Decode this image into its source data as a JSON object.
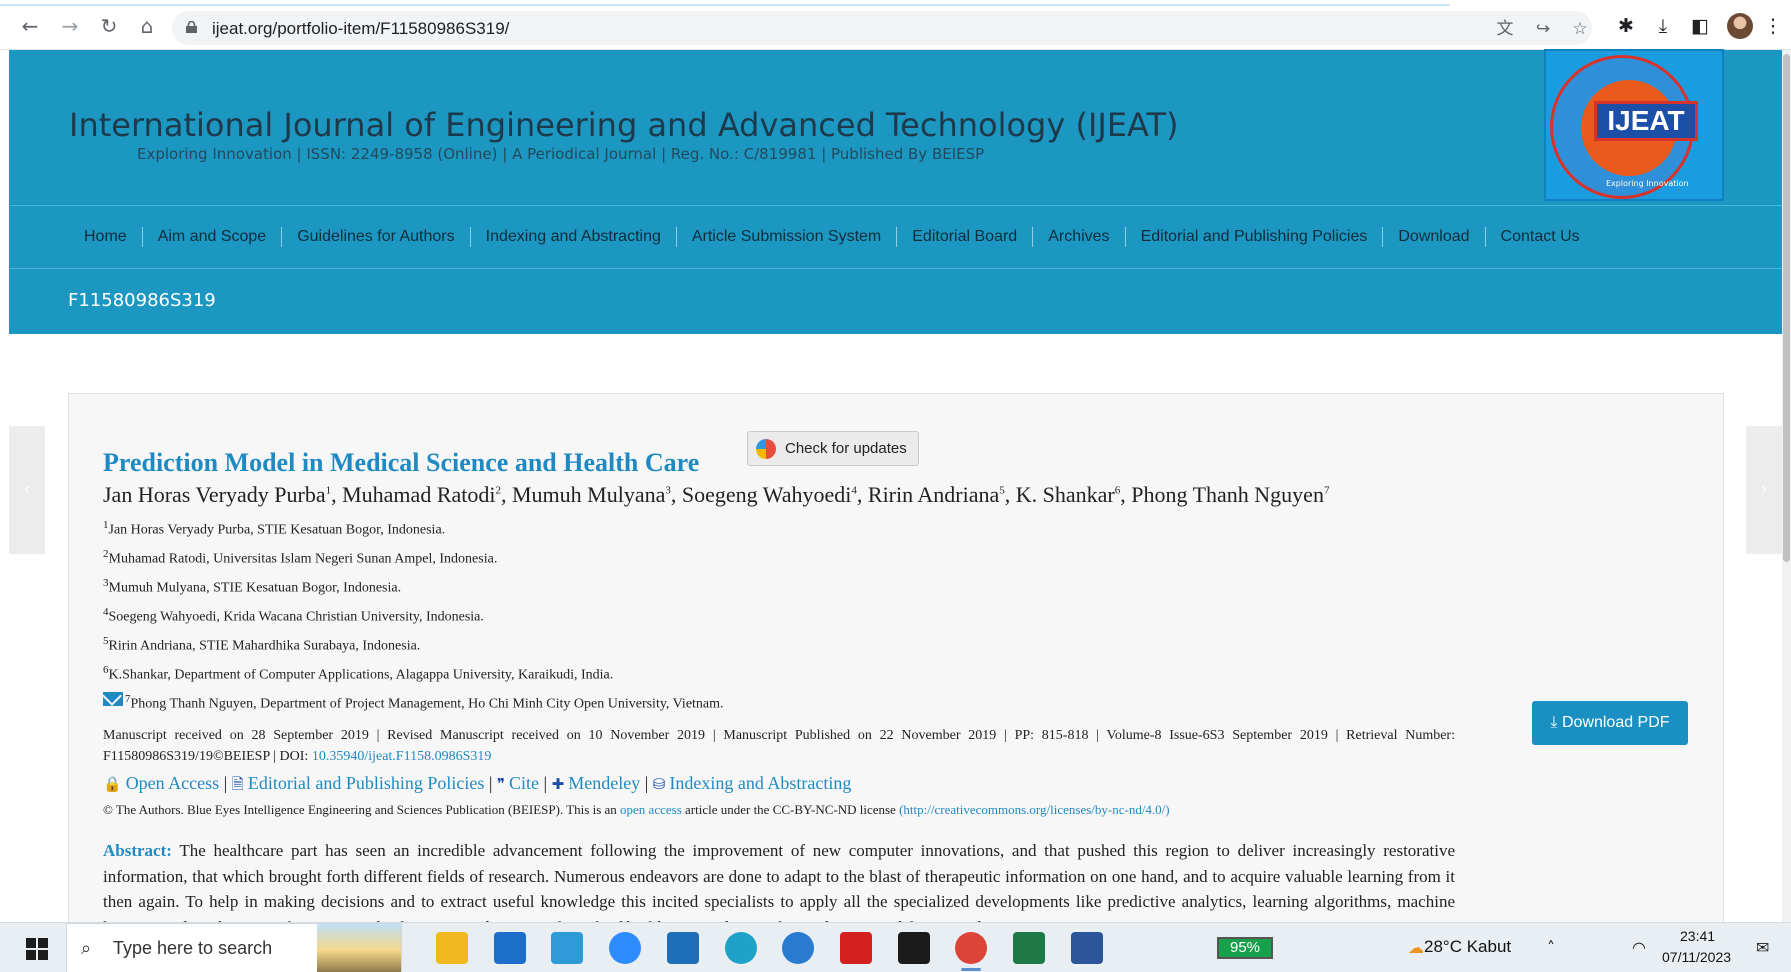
{
  "browser": {
    "url": "ijeat.org/portfolio-item/F11580986S319/",
    "nav_icons": [
      "back-arrow-icon",
      "forward-arrow-icon",
      "reload-icon",
      "home-icon"
    ],
    "glyphs": {
      "back": "←",
      "forward": "→",
      "reload": "↻",
      "home": "⌂",
      "translate": "文",
      "share": "↪",
      "star": "☆",
      "puzzle": "✱",
      "download": "⤓",
      "sidepanel": "◧",
      "menu": "⋮"
    }
  },
  "site": {
    "title": "International Journal of Engineering and Advanced Technology (IJEAT)",
    "subtitle": "Exploring Innovation | ISSN: 2249-8958 (Online) | A Periodical Journal | Reg. No.: C/819981 | Published By BEIESP",
    "logo_text": "IJEAT",
    "logo_tagline": "Exploring Innovation",
    "nav": [
      "Home",
      "Aim and Scope",
      "Guidelines for Authors",
      "Indexing and Abstracting",
      "Article Submission System",
      "Editorial Board",
      "Archives",
      "Editorial and Publishing Policies",
      "Download",
      "Contact Us"
    ],
    "page_id": "F11580986S319",
    "prev_arrow": "‹",
    "next_arrow": "›"
  },
  "article": {
    "title": "Prediction Model in Medical Science and Health Care",
    "check_updates": "Check for updates",
    "authors": [
      {
        "name": "Jan Horas Veryady Purba",
        "n": "1"
      },
      {
        "name": "Muhamad Ratodi",
        "n": "2"
      },
      {
        "name": "Mumuh Mulyana",
        "n": "3"
      },
      {
        "name": "Soegeng Wahyoedi",
        "n": "4"
      },
      {
        "name": "Ririn Andriana",
        "n": "5"
      },
      {
        "name": "K. Shankar",
        "n": "6"
      },
      {
        "name": "Phong Thanh Nguyen",
        "n": "7"
      }
    ],
    "affiliations": [
      {
        "n": "1",
        "text": "Jan Horas Veryady Purba, STIE Kesatuan Bogor, Indonesia."
      },
      {
        "n": "2",
        "text": "Muhamad Ratodi, Universitas Islam Negeri Sunan Ampel, Indonesia."
      },
      {
        "n": "3",
        "text": "Mumuh Mulyana, STIE Kesatuan Bogor, Indonesia."
      },
      {
        "n": "4",
        "text": "Soegeng Wahyoedi, Krida Wacana Christian University, Indonesia."
      },
      {
        "n": "5",
        "text": "Ririn Andriana, STIE Mahardhika Surabaya, Indonesia."
      },
      {
        "n": "6",
        "text": "K.Shankar, Department of Computer Applications, Alagappa University, Karaikudi, India."
      },
      {
        "n": "7",
        "text": "Phong Thanh Nguyen, Department of Project Management, Ho Chi Minh City Open University, Vietnam."
      }
    ],
    "meta_line": "Manuscript received on 28 September 2019 | Revised Manuscript received on 10 November 2019 | Manuscript Published on 22 November 2019 | PP: 815-818 | Volume-8 Issue-6S3 September 2019 | Retrieval Number:",
    "retrieval": "F11580986S319/19©BEIESP | DOI: ",
    "doi": "10.35940/ijeat.F1158.0986S319",
    "links": {
      "open_access": "Open Access",
      "policies": "Editorial and Publishing Policies",
      "cite": "Cite",
      "mendeley": "Mendeley",
      "indexing": "Indexing and Abstracting",
      "sep": " | ",
      "glyphs": {
        "lock": "🔒",
        "doc": "🗎",
        "quote": "❞",
        "plus": "✚",
        "db": "⛁"
      }
    },
    "license_pre": "© The Authors. Blue Eyes Intelligence Engineering and Sciences Publication (BEIESP). This is an ",
    "license_link": "open access",
    "license_mid": " article under the CC-BY-NC-ND license ",
    "license_url": "(http://creativecommons.org/licenses/by-nc-nd/4.0/)",
    "download_pdf": "Download PDF",
    "abstract_label": "Abstract:",
    "abstract_text": "The healthcare part has seen an incredible advancement following the improvement of new computer innovations, and that pushed this region to deliver increasingly restorative information, that which brought forth different fields of research. Numerous endeavors are done to adapt to the blast of therapeutic information on one hand, and to acquire valuable learning from it then again. To help in making decisions and to extract useful knowledge this incited specialists to apply all the specialized developments like predictive analytics, learning algorithms, machine learning and predictive analytics. In medical science to determine the risk of building up a disease the prediction models are used"
  },
  "taskbar": {
    "search_placeholder": "Type here to search",
    "search_glyph": "⌕",
    "battery": "95%",
    "weather": "28°C  Kabut",
    "time": "23:41",
    "date": "07/11/2023",
    "apps": [
      "file-explorer",
      "mail",
      "l-app",
      "zoom",
      "forms",
      "edge",
      "network-app",
      "acrobat",
      "webex",
      "chrome",
      "excel",
      "word"
    ],
    "tray_glyphs": {
      "chevron": "˄",
      "wifi": "◠",
      "notify": "✉"
    }
  }
}
